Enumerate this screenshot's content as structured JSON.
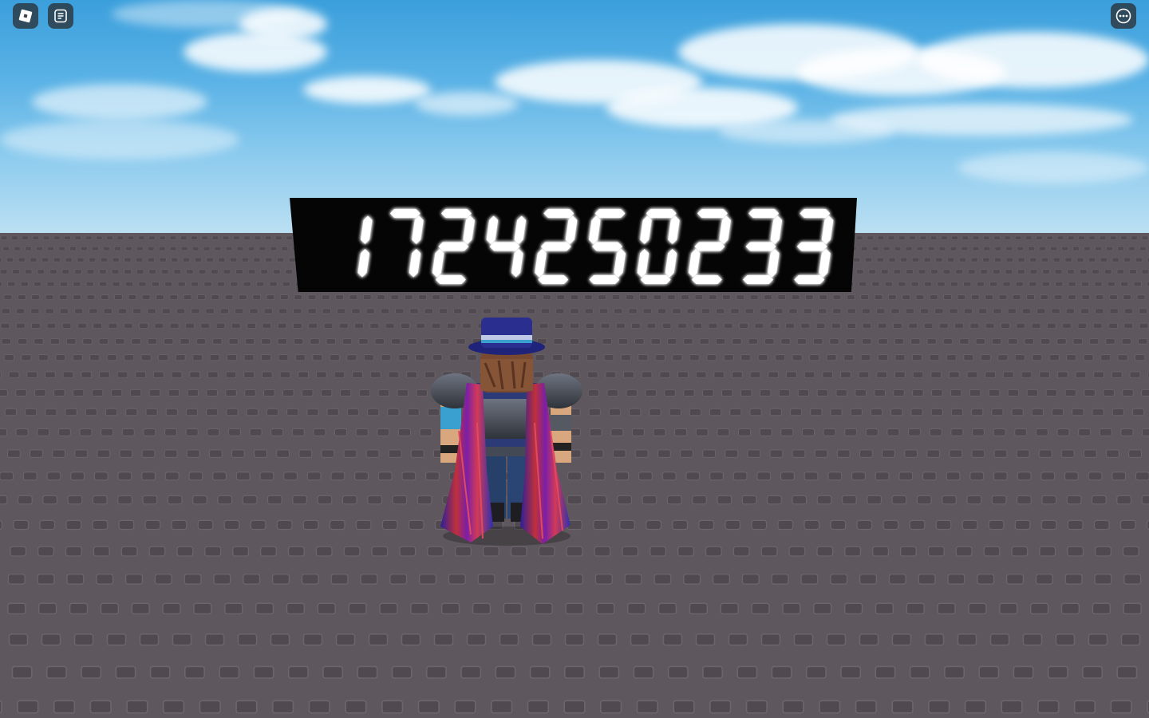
{
  "scene": {
    "type": "roblox-baseplate",
    "sky_color": "#5cb3e6",
    "ground_color": "#5e585e"
  },
  "topbar": {
    "left_buttons": [
      {
        "name": "roblox-menu",
        "icon": "roblox-logo-icon"
      },
      {
        "name": "chat",
        "icon": "chat-icon"
      }
    ],
    "right_buttons": [
      {
        "name": "more-options",
        "icon": "ellipsis-icon"
      }
    ]
  },
  "billboard": {
    "display_value": "1724250233",
    "text_color": "#ffffff",
    "background_color": "#050505"
  },
  "avatar": {
    "description": "player-avatar",
    "hat_color": "#2a2f8f"
  }
}
